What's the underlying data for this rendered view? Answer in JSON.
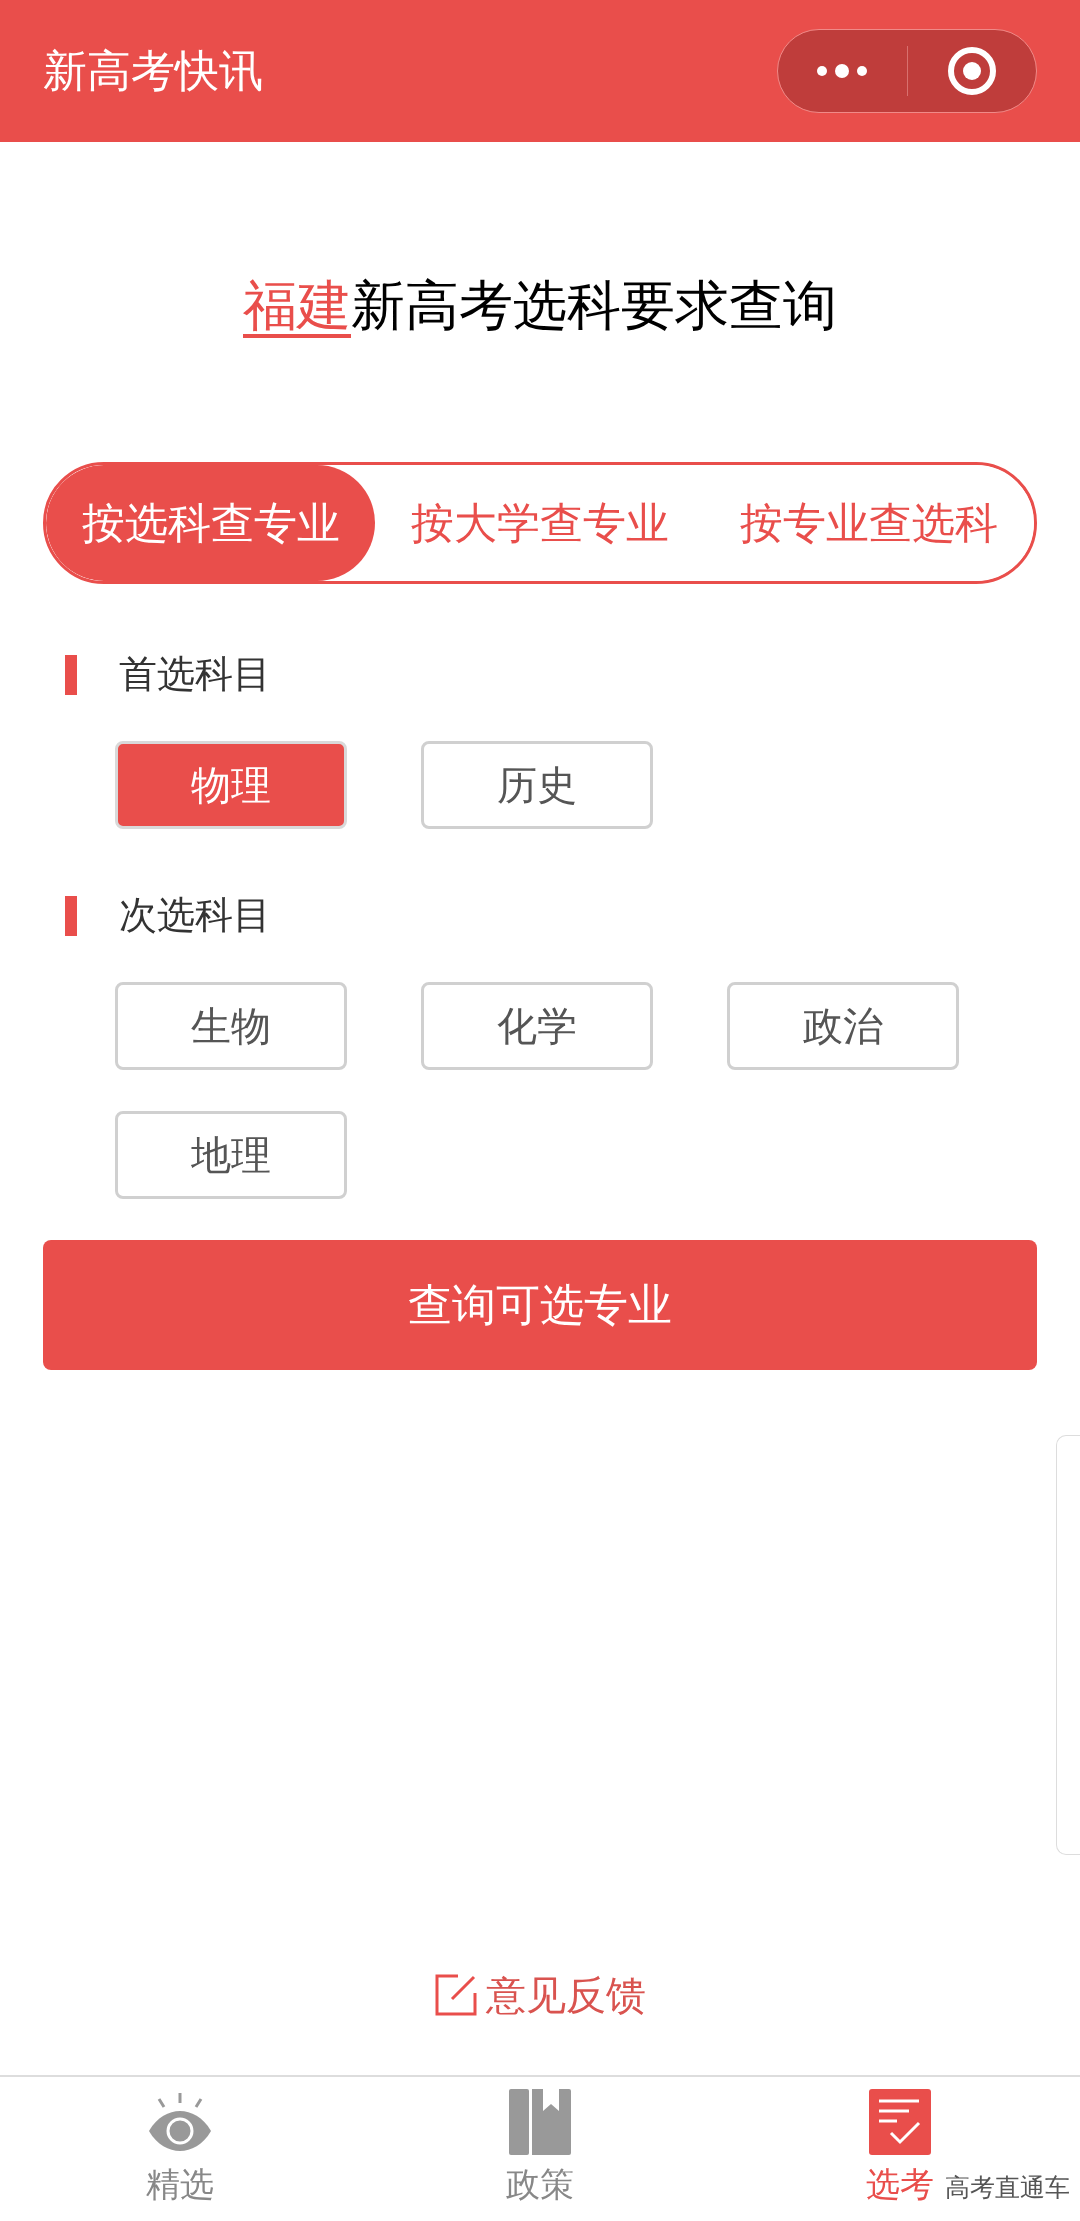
{
  "header": {
    "title": "新高考快讯"
  },
  "heading": {
    "province": "福建",
    "text": "新高考选科要求查询"
  },
  "tabs": [
    {
      "label": "按选科查专业",
      "selected": true
    },
    {
      "label": "按大学查专业",
      "selected": false
    },
    {
      "label": "按专业查选科",
      "selected": false
    }
  ],
  "sections": [
    {
      "title": "首选科目",
      "options": [
        {
          "label": "物理",
          "selected": true
        },
        {
          "label": "历史",
          "selected": false
        }
      ]
    },
    {
      "title": "次选科目",
      "options": [
        {
          "label": "生物",
          "selected": false
        },
        {
          "label": "化学",
          "selected": false
        },
        {
          "label": "政治",
          "selected": false
        },
        {
          "label": "地理",
          "selected": false
        }
      ]
    }
  ],
  "query_button": "查询可选专业",
  "feedback": "意见反馈",
  "nav": [
    {
      "kind": "eye",
      "label": "精选",
      "selected": false
    },
    {
      "kind": "book",
      "label": "政策",
      "selected": false
    },
    {
      "kind": "list",
      "label": "选考",
      "selected": true
    }
  ],
  "nav_caption": "高考直通车"
}
